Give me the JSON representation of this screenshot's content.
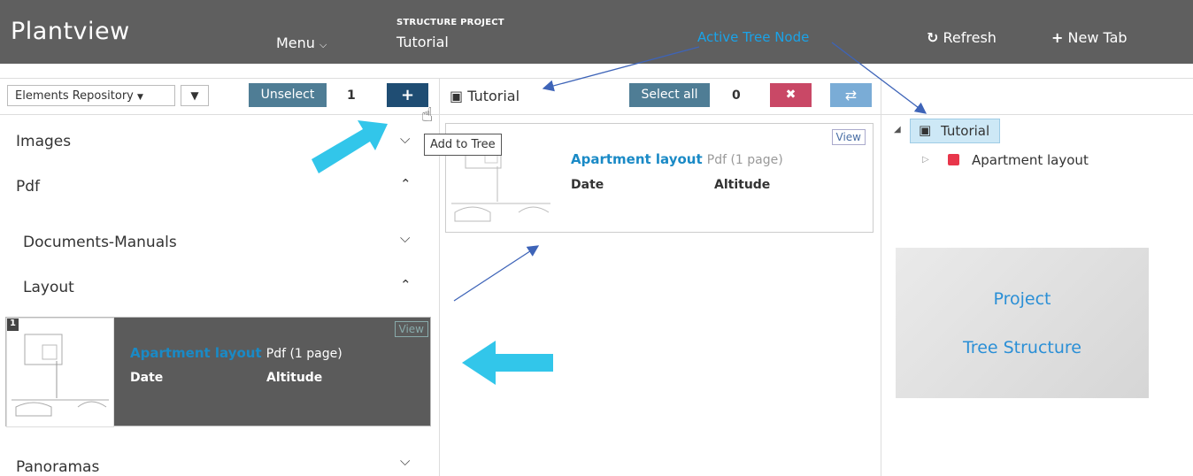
{
  "app": {
    "title": "Plantview",
    "menu_label": "Menu"
  },
  "project": {
    "label": "STRUCTURE PROJECT",
    "name": "Tutorial"
  },
  "header_actions": {
    "refresh": "Refresh",
    "new_tab": "New Tab"
  },
  "annotations": {
    "active_tree_node": "Active Tree Node",
    "tree_box_line1": "Project",
    "tree_box_line2": "Tree Structure"
  },
  "left_panel": {
    "repository_select": "Elements Repository",
    "unselect_label": "Unselect",
    "selected_count": "1",
    "add_tooltip": "Add to Tree",
    "categories": {
      "images": "Images",
      "pdf": "Pdf",
      "documents_manuals": "Documents-Manuals",
      "layout": "Layout",
      "panoramas": "Panoramas"
    },
    "card": {
      "index": "1",
      "title": "Apartment layout",
      "type": "Pdf (1 page)",
      "date_label": "Date",
      "altitude_label": "Altitude",
      "view": "View"
    }
  },
  "middle_panel": {
    "crumb": "Tutorial",
    "select_all_label": "Select all",
    "count": "0",
    "card": {
      "title": "Apartment layout",
      "type": "Pdf (1 page)",
      "date_label": "Date",
      "altitude_label": "Altitude",
      "view": "View"
    }
  },
  "tree": {
    "root": "Tutorial",
    "child": "Apartment layout"
  },
  "colors": {
    "topbar": "#5f5f5f",
    "accent_blue": "#1a8ac6",
    "annotation_cyan": "#32c6ea",
    "delete_red": "#c94866"
  }
}
